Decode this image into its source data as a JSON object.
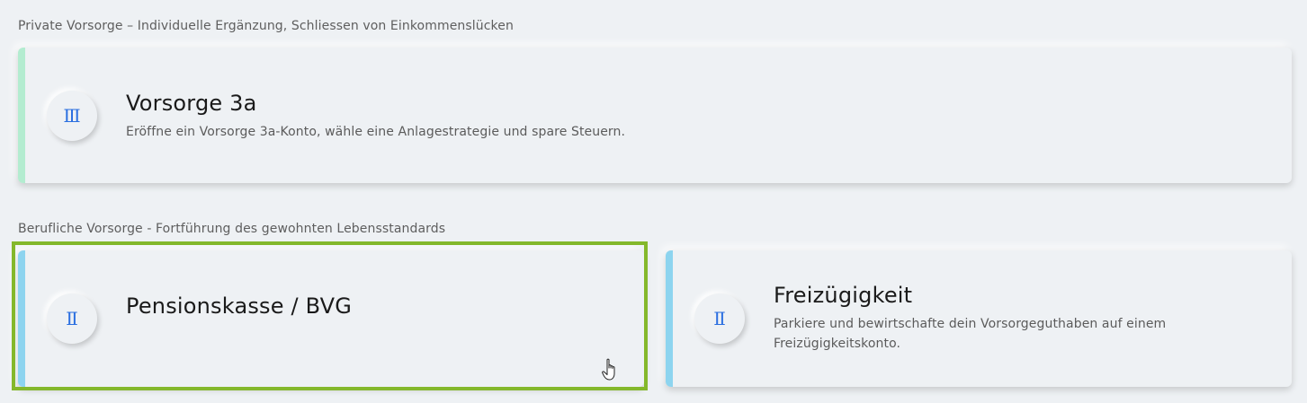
{
  "sections": [
    {
      "label": "Private Vorsorge – Individuelle Ergänzung, Schliessen von Einkommenslücken",
      "cards": [
        {
          "icon": "pillar-3-icon",
          "numeral": "Ⅲ",
          "title": "Vorsorge 3a",
          "description": "Eröffne ein Vorsorge 3a-Konto, wähle eine Anlagestrategie und spare Steuern.",
          "accent_color": "#b3ecd0"
        }
      ]
    },
    {
      "label": "Berufliche Vorsorge - Fortführung des gewohnten Lebensstandards",
      "cards": [
        {
          "icon": "pillar-2-icon",
          "numeral": "Ⅱ",
          "title": "Pensionskasse / BVG",
          "description": "",
          "accent_color": "#8dd4ef"
        },
        {
          "icon": "pillar-2-icon",
          "numeral": "Ⅱ",
          "title": "Freizügigkeit",
          "description_line1": "Parkiere und bewirtschafte dein Vorsorgeguthaben auf einem",
          "description_line2": "Freizügigkeitskonto.",
          "accent_color": "#8dd4ef"
        }
      ]
    }
  ],
  "colors": {
    "background": "#eef1f4",
    "icon_blue": "#2b6fe0",
    "selection_outline": "#84b82b"
  }
}
